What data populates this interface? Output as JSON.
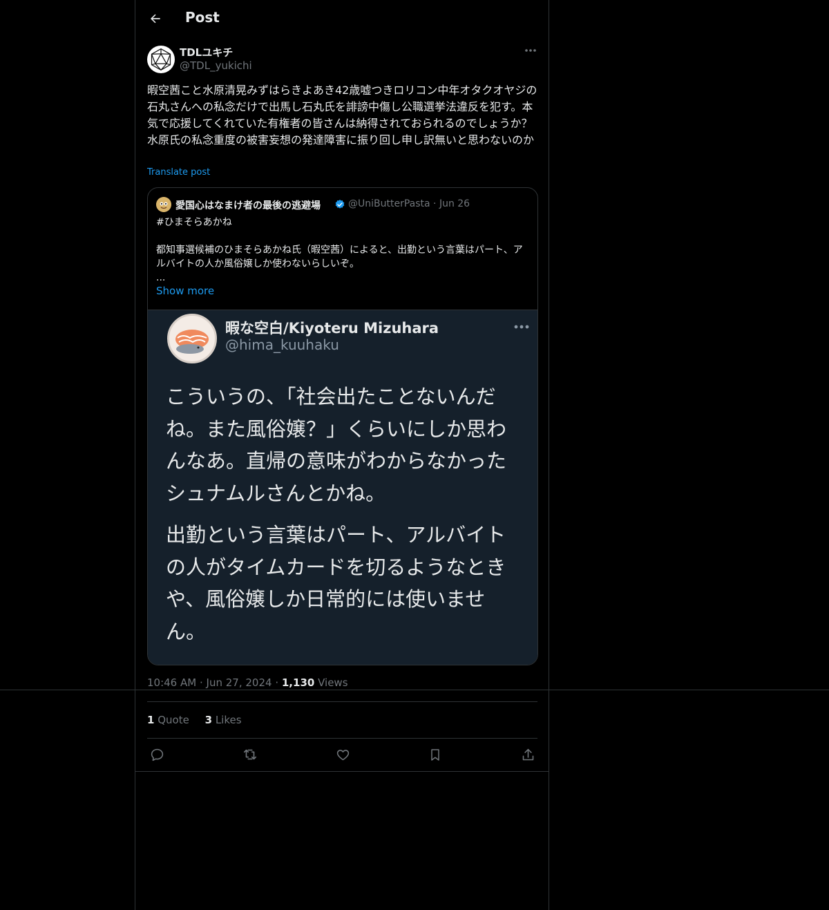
{
  "header": {
    "title": "Post"
  },
  "post": {
    "author_name": "TDLユキチ",
    "author_handle": "@TDL_yukichi",
    "text": "暇空茜こと水原清晃みずはらきよあき42歳嘘つきロリコン中年オタクオヤジの石丸さんへの私念だけで出馬し石丸氏を誹謗中傷し公職選挙法違反を犯す。本気で応援してくれていた有権者の皆さんは納得されておられるのでしょうか？水原氏の私念重度の被害妄想の発達障害に振り回し申し訳無いと思わないのか",
    "translate_label": "Translate post",
    "time": "10:46 AM",
    "date": "Jun 27, 2024",
    "views_count": "1,130",
    "views_label": "Views",
    "quotes_count": "1",
    "quotes_label": "Quote",
    "likes_count": "3",
    "likes_label": "Likes"
  },
  "quoted": {
    "author_name": "愛国心はなまけ者の最後の逃避場",
    "author_handle": "@UniButterPasta",
    "date": "Jun 26",
    "text": "#ひまそらあかね\n\n都知事選候補のひまそらあかね氏（暇空茜）によると、出勤という言葉はパート、アルバイトの人か風俗嬢しか使わないらしいぞ。\n...",
    "show_more": "Show more",
    "image": {
      "name": "暇な空白/Kiyoteru Mizuhara",
      "handle": "@hima_kuuhaku",
      "paragraph1": "こういうの、「社会出たことないんだね。また風俗嬢？」くらいにしか思わんなあ。直帰の意味がわからなかったシュナムルさんとかね。",
      "paragraph2": "出勤という言葉はパート、アルバイトの人がタイムカードを切るようなときや、風俗嬢しか日常的には使いません。"
    }
  },
  "icons": {
    "back": "arrow-left-icon",
    "more": "more-horizontal-icon",
    "verified": "verified-badge-icon",
    "reply": "reply-icon",
    "repost": "repost-icon",
    "like": "heart-icon",
    "bookmark": "bookmark-icon",
    "share": "share-icon"
  },
  "colors": {
    "background": "#000000",
    "text": "#e7e9ea",
    "secondary_text": "#71767b",
    "link": "#1d9bf0",
    "border": "#2f3336",
    "image_background": "#15202b"
  }
}
